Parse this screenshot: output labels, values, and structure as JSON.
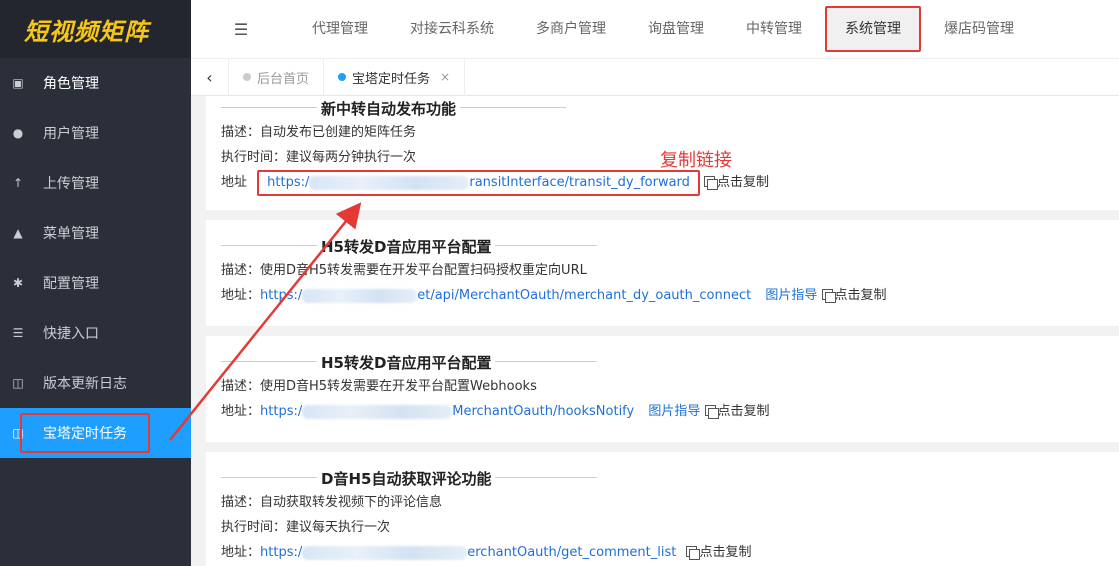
{
  "app": {
    "logo_text": "短视频矩阵"
  },
  "sidebar": {
    "items": [
      {
        "label": "角色管理",
        "icon": "role-icon"
      },
      {
        "label": "用户管理",
        "icon": "user-icon"
      },
      {
        "label": "上传管理",
        "icon": "upload-icon"
      },
      {
        "label": "菜单管理",
        "icon": "tree-icon"
      },
      {
        "label": "配置管理",
        "icon": "gear-icon"
      },
      {
        "label": "快捷入口",
        "icon": "list-icon"
      },
      {
        "label": "版本更新日志",
        "icon": "book-icon"
      },
      {
        "label": "宝塔定时任务",
        "icon": "book-icon"
      }
    ]
  },
  "topnav": {
    "items": [
      "代理管理",
      "对接云科系统",
      "多商户管理",
      "询盘管理",
      "中转管理",
      "系统管理",
      "爆店码管理"
    ],
    "selected": "系统管理"
  },
  "tabs": {
    "items": [
      {
        "label": "后台首页"
      },
      {
        "label": "宝塔定时任务",
        "close": "×"
      }
    ]
  },
  "annotation": {
    "copy_link_label": "复制链接"
  },
  "cards": [
    {
      "title": "新中转自动发布功能",
      "desc": "描述：自动发布已创建的矩阵任务",
      "time": "执行时间：建议每两分钟执行一次",
      "addr_label": "地址",
      "url_start": "https:/",
      "url_end": "ransitInterface/transit_dy_forward",
      "copy": "点击复制"
    },
    {
      "title": "H5转发D音应用平台配置",
      "desc": "描述：使用D音H5转发需要在开发平台配置扫码授权重定向URL",
      "addr_label": "地址：",
      "url_start": "https:/",
      "url_end": "et/api/MerchantOauth/merchant_dy_oauth_connect",
      "guide": "图片指导",
      "copy": "点击复制"
    },
    {
      "title": "H5转发D音应用平台配置",
      "desc": "描述：使用D音H5转发需要在开发平台配置Webhooks",
      "addr_label": "地址：",
      "url_start": "https:/",
      "url_end": "MerchantOauth/hooksNotify",
      "guide": "图片指导",
      "copy": "点击复制"
    },
    {
      "title": "D音H5自动获取评论功能",
      "desc": "描述：自动获取转发视频下的评论信息",
      "time": "执行时间：建议每天执行一次",
      "addr_label": "地址：",
      "url_start": "https:/",
      "url_end": "erchantOauth/get_comment_list",
      "copy": "点击复制"
    }
  ],
  "colors": {
    "accent": "#1e9fff",
    "annotation": "#e53935",
    "logo": "#f5c518"
  }
}
